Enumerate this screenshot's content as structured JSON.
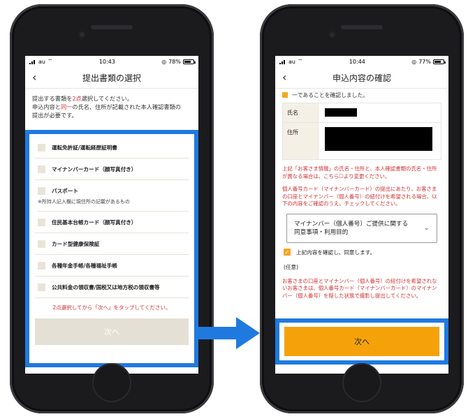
{
  "left": {
    "status": {
      "carrier": "au",
      "time": "10:43",
      "battery": "78%"
    },
    "nav": {
      "back": "‹",
      "title": "提出書類の選択"
    },
    "intro": {
      "line1a": "提出する書類を",
      "line1b": "2点",
      "line1c": "選択してください。",
      "line2a": "申込内容と",
      "line2b": "同一",
      "line2c": "の氏名、住所が記載された本人確認書類の",
      "line3": "提出が必要です。"
    },
    "documents": [
      "運転免許証/運転経歴証明書",
      "マイナンバーカード（顔写真付き）",
      "パスポート",
      "住民基本台帳カード（顔写真付き）",
      "カード型健康保険証",
      "各種年金手帳/各種福祉手帳",
      "公共料金の領収書/国税又は地方税の領収書等"
    ],
    "passport_note": "※所持人記入欄に現住所の記載があるもの",
    "instruction": "2点選択してから「次へ」をタップしてください。",
    "next_label": "次へ"
  },
  "right": {
    "status": {
      "carrier": "au",
      "time": "10:44",
      "battery": "77%"
    },
    "nav": {
      "back": "‹",
      "title": "申込内容の確認"
    },
    "confirm_line": "一であることを確認しました。",
    "info": {
      "name_label": "氏名",
      "address_label": "住所"
    },
    "notice1": "上記「お客さま情報」の氏名・住所と、本人確認書類の氏名・住所が異なる場合は、こちら☐より変更ください。",
    "notice2": "個人番号カード（マイナンバーカード）の提出にあたり、お客さまの口座とマイナンバー（個人番号）の紐付けを希望される場合、以下の内容をご確認のうえ、チェックしてください。",
    "select_line1": "マイナンバー（個人番号）ご提供に関する",
    "select_line2": "同意事項・利用目的",
    "agree": "上記内容を確認し、同意します。",
    "optional": "(任意)",
    "notice3": "お客さまの口座とマイナンバー（個人番号）の紐付けを希望されないお客さまは、個人番号カード（マイナンバーカード）のマイナンバー（個人番号）を隠した状態で撮影し提出してください。",
    "next_label": "次へ"
  },
  "colors": {
    "accent_blue": "#1f7ae0",
    "orange": "#f5a20a",
    "red": "#d32f2f"
  }
}
